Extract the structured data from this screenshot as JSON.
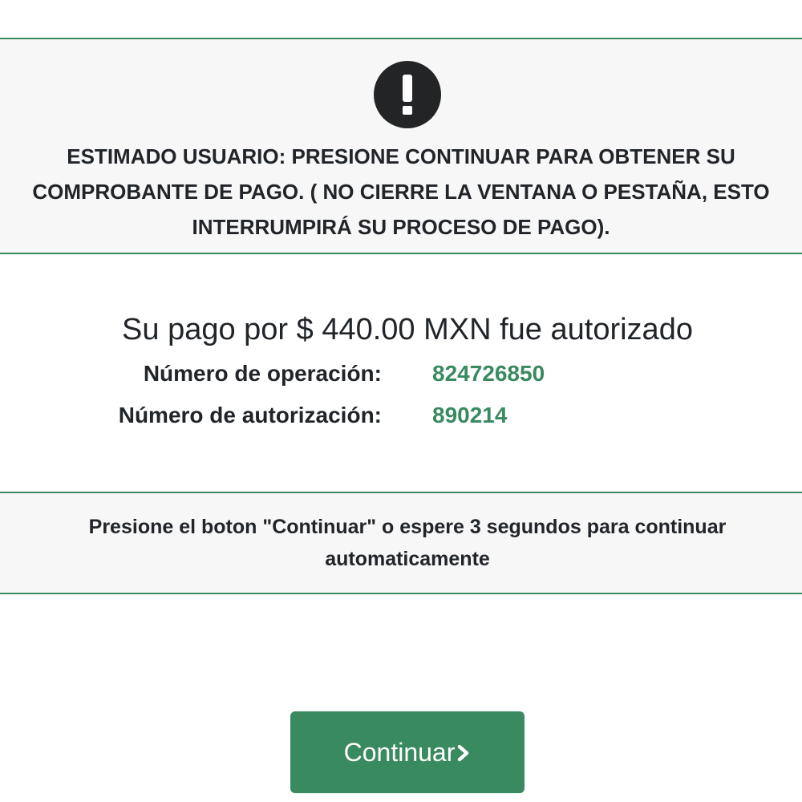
{
  "alert": {
    "icon": "exclamation-circle-icon",
    "message": "ESTIMADO USUARIO: PRESIONE CONTINUAR PARA OBTENER SU COMPROBANTE DE PAGO. ( NO CIERRE LA VENTANA O PESTAÑA, ESTO INTERRUMPIRÁ SU PROCESO DE PAGO)."
  },
  "payment": {
    "summary": "Su pago por $ 440.00 MXN fue autorizado",
    "operation_label": "Número de operación:",
    "operation_value": "824726850",
    "authorization_label": "Número de autorización:",
    "authorization_value": "890214"
  },
  "notice": {
    "message": "Presione el boton \"Continuar\" o espere 3 segundos para continuar automaticamente"
  },
  "button": {
    "label": "Continuar",
    "icon": "chevron-right-icon"
  },
  "colors": {
    "accent": "#3a8a5f",
    "panel_background": "#f7f7f7",
    "text": "#212529",
    "icon_dark": "#222426"
  }
}
